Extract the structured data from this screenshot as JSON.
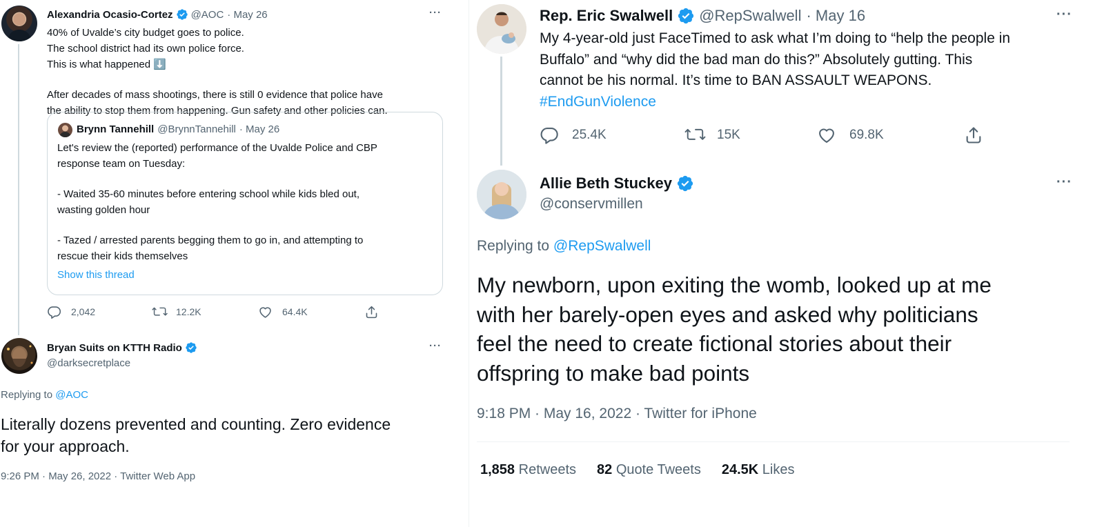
{
  "left": {
    "aoc_tweet": {
      "name": "Alexandria Ocasio-Cortez",
      "handle": "@AOC",
      "date": "· May 26",
      "paragraph1": "40% of Uvalde’s city budget goes to police. The school district had its own police force. This is what happened ⬇️",
      "paragraph2_line1": "After decades of mass shootings, there is still 0 evidence that police have",
      "paragraph2_line2": "the ability to stop them from happening. Gun safety and other policies can.",
      "more": "···",
      "quote": {
        "name": "Brynn Tannehill",
        "handle": "@BrynnTannehill",
        "date": "· May 26",
        "line1": "Let's review the (reported) performance of the Uvalde Police and CBP",
        "line2": "response team on Tuesday:",
        "line3": "- Waited 35-60 minutes before entering school while kids bled out,",
        "line4": "wasting golden hour",
        "line5": "- Tazed / arrested parents begging them to go in, and attempting to",
        "line6": "rescue their kids themselves",
        "show_thread": "Show this thread"
      },
      "replies": "2,042",
      "retweets": "12.2K",
      "likes": "64.4K"
    },
    "suits_tweet": {
      "name": "Bryan Suits on KTTH Radio",
      "handle": "@darksecretplace",
      "more": "···",
      "replying_prefix": "Replying to ",
      "replying_handle": "@AOC",
      "line1": "Literally dozens prevented and counting. Zero evidence",
      "line2": "for your approach.",
      "timestamp": "9:26 PM · May 26, 2022 · Twitter Web App"
    }
  },
  "right": {
    "swalwell_tweet": {
      "name": "Rep. Eric Swalwell",
      "handle": "@RepSwalwell",
      "date": "· May 16",
      "more": "···",
      "line1": "My 4-year-old just FaceTimed to ask what I’m doing to “help the people in",
      "line2": "Buffalo” and “why did the bad man do this?” Absolutely gutting. This",
      "line3": "cannot be his normal. It’s time to BAN ASSAULT WEAPONS.",
      "hashtag": "#EndGunViolence",
      "replies": "25.4K",
      "retweets": "15K",
      "likes": "69.8K"
    },
    "stuckey_tweet": {
      "name": "Allie Beth Stuckey",
      "handle": "@conservmillen",
      "more": "···",
      "replying_prefix": "Replying to ",
      "replying_handle": "@RepSwalwell",
      "line1": "My newborn, upon exiting the womb, looked up at me",
      "line2": "with her barely-open eyes and asked why politicians",
      "line3": "feel the need to create fictional stories about their",
      "line4": "offspring to make bad points",
      "timestamp": "9:18 PM · May 16, 2022 · Twitter for iPhone",
      "retweets_count": "1,858",
      "retweets_label": "Retweets",
      "quotes_count": "82",
      "quotes_label": "Quote Tweets",
      "likes_count": "24.5K",
      "likes_label": "Likes"
    }
  },
  "colors": {
    "link": "#1d9bf0",
    "secondary_text": "#536471",
    "primary_text": "#0f1419",
    "border": "#cfd9de"
  },
  "icons": [
    "verified-badge-icon",
    "more-options-icon",
    "reply-icon",
    "retweet-icon",
    "like-icon",
    "share-icon"
  ]
}
